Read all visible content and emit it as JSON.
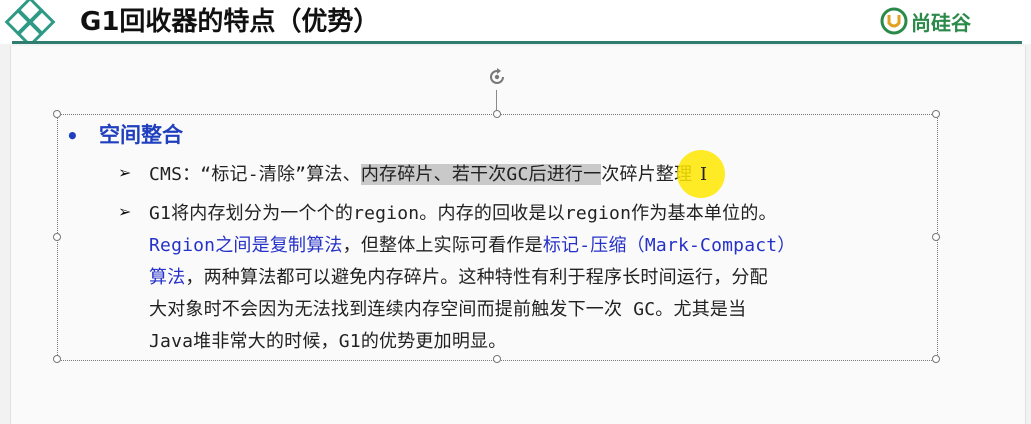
{
  "header": {
    "title": "G1回收器的特点（优势）",
    "brand_name": "尚硅谷",
    "accent_color": "#2e7d6e",
    "brand_color": "#2b8a4a"
  },
  "content": {
    "bullet": "•",
    "heading": "空间整合",
    "heading_color": "#1f3fbf",
    "items": [
      {
        "marker": "➢",
        "seg1": "CMS：“标记-清除”算法、",
        "seg2_highlighted": "内存碎片、若干次GC后进行一",
        "seg3": "次碎片整理"
      },
      {
        "marker": "➢",
        "line1": "G1将内存划分为一个个的region。内存的回收是以region作为基本单位的。",
        "line2_blue1": "Region之间是复制算法",
        "line2_black": "，但整体上实际可看作是",
        "line2_blue2": "标记-压缩（Mark-Compact）",
        "line3_blue": "算法",
        "line3_black": "，两种算法都可以避免内存碎片。这种特性有利于程序长时间运行，分配",
        "line4": "大对象时不会因为无法找到连续内存空间而提前触发下一次 GC。尤其是当",
        "line5": "Java堆非常大的时候，G1的优势更加明显。"
      }
    ]
  },
  "icons": {
    "logo": "diamond-logo-icon",
    "brand": "brand-logo-icon",
    "rotate": "rotate-handle-icon",
    "cursor": "text-cursor-icon"
  }
}
